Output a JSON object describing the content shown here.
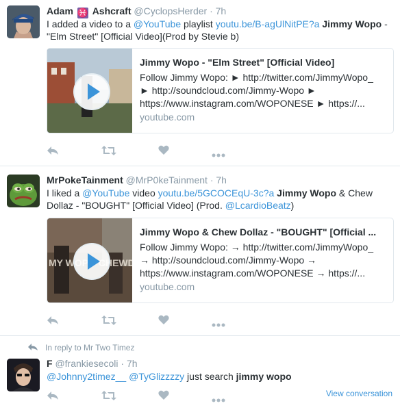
{
  "tweets": [
    {
      "name": "Adam",
      "name_suffix": "Ashcraft",
      "handle": "@CyclopsHerder",
      "time": "7h",
      "text": {
        "a": "I added a video to a ",
        "mention": "@YouTube",
        "b": " playlist ",
        "url": "youtu.be/B-agUlNitPE?a",
        "bold": "Jimmy Wopo",
        "c": " - \"Elm Street\" [Official Video](Prod by Stevie b)"
      },
      "card": {
        "title": "Jimmy Wopo - \"Elm Street\" [Official Video]",
        "desc1": "Follow Jimmy Wopo: ► http://twitter.com/JimmyWopo_",
        "desc2": "► http://soundcloud.com/Jimmy-Wopo ►",
        "desc3": "https://www.instagram.com/WOPONESE ► https://...",
        "domain": "youtube.com"
      }
    },
    {
      "name": "MrPokeTainment",
      "handle": "@MrP0keTainment",
      "time": "7h",
      "text": {
        "a": "I liked a ",
        "mention": "@YouTube",
        "b": " video ",
        "url": "youtu.be/5GCOCEqU-3c?a",
        "bold": "Jimmy Wopo",
        "c": " & Chew Dollaz - \"BOUGHT\" [Official Video] (Prod. ",
        "mention2": "@LcardioBeatz",
        "d": ")"
      },
      "card": {
        "title": "Jimmy Wopo & Chew Dollaz - \"BOUGHT\" [Official ...",
        "desc1": "Follow Jimmy Wopo: → http://twitter.com/JimmyWopo_",
        "desc2": "→ http://soundcloud.com/Jimmy-Wopo →",
        "desc3": "https://www.instagram.com/WOPONESE → https://...",
        "domain": "youtube.com"
      }
    },
    {
      "reply_note": "In reply to Mr Two Timez",
      "name": "F",
      "handle": "@frankiesecoli",
      "time": "7h",
      "text": {
        "mention": "@Johnny2timez__",
        "mention2": "@TyGlizzzzy",
        "a": " just search ",
        "bold": "jimmy wopo"
      },
      "view_conversation": "View conversation"
    }
  ],
  "icons": {
    "reply": "reply-icon",
    "retweet": "retweet-icon",
    "like": "heart-icon",
    "more": "more-icon"
  },
  "colors": {
    "link": "#3b94d9",
    "muted": "#8899a6",
    "icon": "#aab8c2",
    "divider": "#e1e8ed",
    "pisces": "#7b5ea7"
  }
}
